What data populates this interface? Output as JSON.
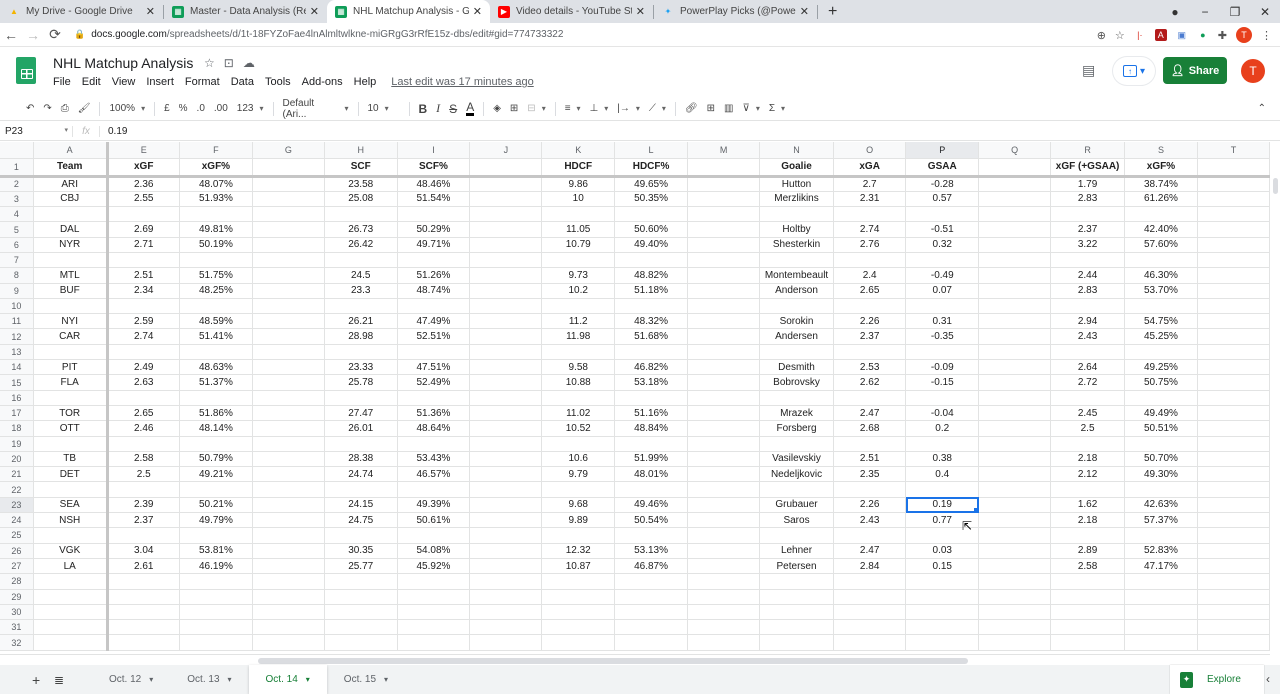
{
  "browser": {
    "tabs": [
      {
        "title": "My Drive - Google Drive",
        "icon": "google-drive-icon",
        "color": "#f4b400",
        "active": false
      },
      {
        "title": "Master - Data Analysis (Revised)",
        "icon": "sheets-icon",
        "color": "#0f9d58",
        "active": false
      },
      {
        "title": "NHL Matchup Analysis - Google",
        "icon": "sheets-icon",
        "color": "#0f9d58",
        "active": true
      },
      {
        "title": "Video details - YouTube Studio",
        "icon": "youtube-icon",
        "color": "#ff0000",
        "active": false
      },
      {
        "title": "PowerPlay Picks (@PowerPlayPick",
        "icon": "twitter-icon",
        "color": "#1da1f2",
        "active": false
      }
    ],
    "close_glyph": "✕",
    "new_tab_glyph": "+",
    "url_host": "docs.google.com",
    "url_path": "/spreadsheets/d/1t-18FYZoFae4lnAlmltwlkne-miGRgG3rRfE15z-dbs/edit#gid=774733322",
    "profile_initial": "T"
  },
  "doc": {
    "title": "NHL Matchup Analysis",
    "menu": [
      "File",
      "Edit",
      "View",
      "Insert",
      "Format",
      "Data",
      "Tools",
      "Add-ons",
      "Help"
    ],
    "last_edit": "Last edit was 17 minutes ago",
    "share_label": "Share",
    "user_initial": "T"
  },
  "toolbar": {
    "zoom": "100%",
    "currency": "£",
    "percent": "%",
    "dec_decrease": ".0",
    "dec_increase": ".00",
    "more_formats": "123",
    "font": "Default (Ari...",
    "font_size": "10",
    "bold": "B",
    "italic": "I",
    "strike": "S",
    "text_color": "A"
  },
  "formula_bar": {
    "cell_ref": "P23",
    "fx": "fx",
    "value": "0.19"
  },
  "sheet": {
    "columns": [
      "A",
      "E",
      "F",
      "G",
      "H",
      "I",
      "J",
      "K",
      "L",
      "M",
      "N",
      "O",
      "P",
      "Q",
      "R",
      "S",
      "T"
    ],
    "selected_column": "P",
    "selected_row": 23,
    "header_row": [
      "Team",
      "xGF",
      "xGF%",
      "",
      "SCF",
      "SCF%",
      "",
      "HDCF",
      "HDCF%",
      "",
      "Goalie",
      "xGA",
      "GSAA",
      "",
      "xGF (+GSAA)",
      "xGF%",
      ""
    ],
    "rows": [
      {
        "n": 2,
        "cells": [
          "ARI",
          "2.36",
          "48.07%",
          "",
          "23.58",
          "48.46%",
          "",
          "9.86",
          "49.65%",
          "",
          "Hutton",
          "2.7",
          "-0.28",
          "",
          "1.79",
          "38.74%",
          ""
        ]
      },
      {
        "n": 3,
        "cells": [
          "CBJ",
          "2.55",
          "51.93%",
          "",
          "25.08",
          "51.54%",
          "",
          "10",
          "50.35%",
          "",
          "Merzlikins",
          "2.31",
          "0.57",
          "",
          "2.83",
          "61.26%",
          ""
        ]
      },
      {
        "n": 4,
        "cells": []
      },
      {
        "n": 5,
        "cells": [
          "DAL",
          "2.69",
          "49.81%",
          "",
          "26.73",
          "50.29%",
          "",
          "11.05",
          "50.60%",
          "",
          "Holtby",
          "2.74",
          "-0.51",
          "",
          "2.37",
          "42.40%",
          ""
        ]
      },
      {
        "n": 6,
        "cells": [
          "NYR",
          "2.71",
          "50.19%",
          "",
          "26.42",
          "49.71%",
          "",
          "10.79",
          "49.40%",
          "",
          "Shesterkin",
          "2.76",
          "0.32",
          "",
          "3.22",
          "57.60%",
          ""
        ]
      },
      {
        "n": 7,
        "cells": []
      },
      {
        "n": 8,
        "cells": [
          "MTL",
          "2.51",
          "51.75%",
          "",
          "24.5",
          "51.26%",
          "",
          "9.73",
          "48.82%",
          "",
          "Montembeault",
          "2.4",
          "-0.49",
          "",
          "2.44",
          "46.30%",
          ""
        ]
      },
      {
        "n": 9,
        "cells": [
          "BUF",
          "2.34",
          "48.25%",
          "",
          "23.3",
          "48.74%",
          "",
          "10.2",
          "51.18%",
          "",
          "Anderson",
          "2.65",
          "0.07",
          "",
          "2.83",
          "53.70%",
          ""
        ]
      },
      {
        "n": 10,
        "cells": []
      },
      {
        "n": 11,
        "cells": [
          "NYI",
          "2.59",
          "48.59%",
          "",
          "26.21",
          "47.49%",
          "",
          "11.2",
          "48.32%",
          "",
          "Sorokin",
          "2.26",
          "0.31",
          "",
          "2.94",
          "54.75%",
          ""
        ]
      },
      {
        "n": 12,
        "cells": [
          "CAR",
          "2.74",
          "51.41%",
          "",
          "28.98",
          "52.51%",
          "",
          "11.98",
          "51.68%",
          "",
          "Andersen",
          "2.37",
          "-0.35",
          "",
          "2.43",
          "45.25%",
          ""
        ]
      },
      {
        "n": 13,
        "cells": []
      },
      {
        "n": 14,
        "cells": [
          "PIT",
          "2.49",
          "48.63%",
          "",
          "23.33",
          "47.51%",
          "",
          "9.58",
          "46.82%",
          "",
          "Desmith",
          "2.53",
          "-0.09",
          "",
          "2.64",
          "49.25%",
          ""
        ]
      },
      {
        "n": 15,
        "cells": [
          "FLA",
          "2.63",
          "51.37%",
          "",
          "25.78",
          "52.49%",
          "",
          "10.88",
          "53.18%",
          "",
          "Bobrovsky",
          "2.62",
          "-0.15",
          "",
          "2.72",
          "50.75%",
          ""
        ]
      },
      {
        "n": 16,
        "cells": []
      },
      {
        "n": 17,
        "cells": [
          "TOR",
          "2.65",
          "51.86%",
          "",
          "27.47",
          "51.36%",
          "",
          "11.02",
          "51.16%",
          "",
          "Mrazek",
          "2.47",
          "-0.04",
          "",
          "2.45",
          "49.49%",
          ""
        ]
      },
      {
        "n": 18,
        "cells": [
          "OTT",
          "2.46",
          "48.14%",
          "",
          "26.01",
          "48.64%",
          "",
          "10.52",
          "48.84%",
          "",
          "Forsberg",
          "2.68",
          "0.2",
          "",
          "2.5",
          "50.51%",
          ""
        ]
      },
      {
        "n": 19,
        "cells": []
      },
      {
        "n": 20,
        "cells": [
          "TB",
          "2.58",
          "50.79%",
          "",
          "28.38",
          "53.43%",
          "",
          "10.6",
          "51.99%",
          "",
          "Vasilevskiy",
          "2.51",
          "0.38",
          "",
          "2.18",
          "50.70%",
          ""
        ]
      },
      {
        "n": 21,
        "cells": [
          "DET",
          "2.5",
          "49.21%",
          "",
          "24.74",
          "46.57%",
          "",
          "9.79",
          "48.01%",
          "",
          "Nedeljkovic",
          "2.35",
          "0.4",
          "",
          "2.12",
          "49.30%",
          ""
        ]
      },
      {
        "n": 22,
        "cells": []
      },
      {
        "n": 23,
        "cells": [
          "SEA",
          "2.39",
          "50.21%",
          "",
          "24.15",
          "49.39%",
          "",
          "9.68",
          "49.46%",
          "",
          "Grubauer",
          "2.26",
          "0.19",
          "",
          "1.62",
          "42.63%",
          ""
        ]
      },
      {
        "n": 24,
        "cells": [
          "NSH",
          "2.37",
          "49.79%",
          "",
          "24.75",
          "50.61%",
          "",
          "9.89",
          "50.54%",
          "",
          "Saros",
          "2.43",
          "0.77",
          "",
          "2.18",
          "57.37%",
          ""
        ]
      },
      {
        "n": 25,
        "cells": []
      },
      {
        "n": 26,
        "cells": [
          "VGK",
          "3.04",
          "53.81%",
          "",
          "30.35",
          "54.08%",
          "",
          "12.32",
          "53.13%",
          "",
          "Lehner",
          "2.47",
          "0.03",
          "",
          "2.89",
          "52.83%",
          ""
        ]
      },
      {
        "n": 27,
        "cells": [
          "LA",
          "2.61",
          "46.19%",
          "",
          "25.77",
          "45.92%",
          "",
          "10.87",
          "46.87%",
          "",
          "Petersen",
          "2.84",
          "0.15",
          "",
          "2.58",
          "47.17%",
          ""
        ]
      },
      {
        "n": 28,
        "cells": []
      },
      {
        "n": 29,
        "cells": []
      },
      {
        "n": 30,
        "cells": []
      },
      {
        "n": 31,
        "cells": []
      },
      {
        "n": 32,
        "cells": []
      }
    ]
  },
  "sheet_tabs": [
    {
      "label": "Oct. 12",
      "active": false
    },
    {
      "label": "Oct. 13",
      "active": false
    },
    {
      "label": "Oct. 14",
      "active": true
    },
    {
      "label": "Oct. 15",
      "active": false
    }
  ],
  "explore_label": "Explore",
  "colors": {
    "accent_green": "#188038",
    "selection_blue": "#1a73e8",
    "avatar_red": "#e8401c"
  }
}
